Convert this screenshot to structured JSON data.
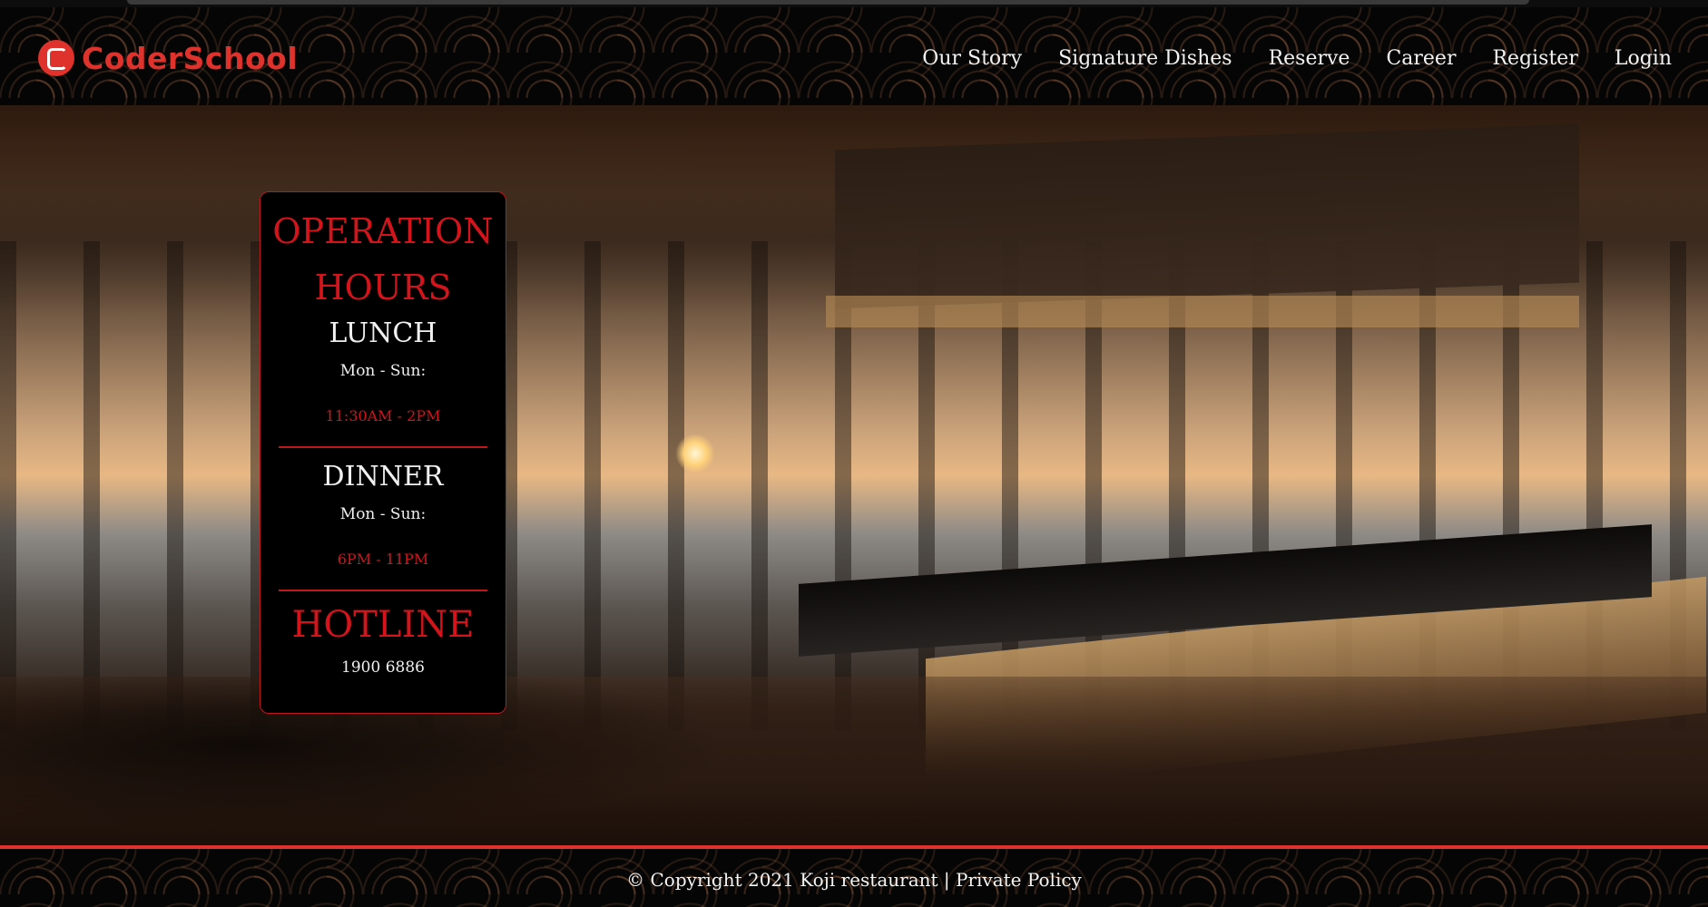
{
  "brand": {
    "name": "CoderSchool",
    "accent": "#e0322c"
  },
  "nav": [
    {
      "label": "Our Story"
    },
    {
      "label": "Signature Dishes"
    },
    {
      "label": "Reserve"
    },
    {
      "label": "Career"
    },
    {
      "label": "Register"
    },
    {
      "label": "Login"
    }
  ],
  "hours": {
    "title_line1": "OPERATION",
    "title_line2": "HOURS",
    "lunch": {
      "heading": "LUNCH",
      "days": "Mon - Sun:",
      "time": "11:30AM - 2PM"
    },
    "dinner": {
      "heading": "DINNER",
      "days": "Mon - Sun:",
      "time": "6PM - 11PM"
    },
    "hotline": {
      "heading": "HOTLINE",
      "number": "1900 6886"
    }
  },
  "footer": {
    "copyright": "© Copyright 2021 Koji restaurant",
    "separator": " | ",
    "policy": "Private Policy"
  }
}
